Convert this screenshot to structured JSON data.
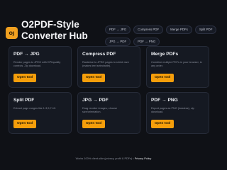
{
  "header": {
    "logo_text": "OJ",
    "title": "O2PDF-Style Converter Hub"
  },
  "nav": {
    "row1": [
      "PDF → JPG",
      "Compress PDF",
      "Merge PDFs",
      "Split PDF"
    ],
    "row2": [
      "JPG → PDF",
      "PDF → PNG"
    ]
  },
  "cards": [
    {
      "title": "PDF → JPG",
      "desc": "Render pages to JPEG with DPI/quality controls. Zip download.",
      "button": "Open tool"
    },
    {
      "title": "Compress PDF",
      "desc": "Rasterize to JPEG pages to shrink size (makes text selectable).",
      "button": "Open tool"
    },
    {
      "title": "Merge PDFs",
      "desc": "Combine multiple PDFs in your browser, in any order.",
      "button": "Open tool"
    },
    {
      "title": "Split PDF",
      "desc": "Extract page ranges like 1-3,5,7-10.",
      "button": "Open tool"
    },
    {
      "title": "JPG → PDF",
      "desc": "Drag reorder images, choose size/orientation.",
      "button": "Open tool"
    },
    {
      "title": "PDF → PNG",
      "desc": "Export pages as PNG (lossless), zip download.",
      "button": "Open tool"
    }
  ],
  "footer": {
    "text": "Works 100% client-side (privacy, profit & PDFs) •",
    "link": "Privacy Policy"
  },
  "colors": {
    "accent": "#f59e0b",
    "background": "#0f1116"
  }
}
